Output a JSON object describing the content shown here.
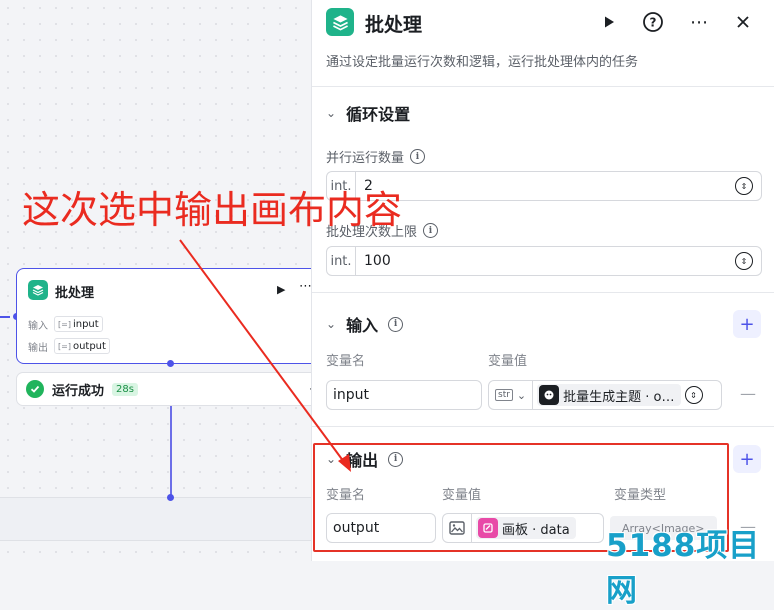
{
  "node": {
    "title": "批处理",
    "input_label": "输入",
    "input_tag": "input",
    "output_label": "输出",
    "output_tag": "output",
    "status": "运行成功",
    "duration": "28s"
  },
  "annotation": {
    "callout": "这次选中输出画布内容"
  },
  "panel": {
    "title": "批处理",
    "description": "通过设定批量运行次数和逻辑，运行批处理体内的任务",
    "loop": {
      "section": "循环设置",
      "parallel_label": "并行运行数量",
      "parallel_type": "int.",
      "parallel_value": "2",
      "limit_label": "批处理次数上限",
      "limit_type": "int.",
      "limit_value": "100"
    },
    "inputs": {
      "section": "输入",
      "col_name": "变量名",
      "col_value": "变量值",
      "rows": [
        {
          "name": "input",
          "type": "str",
          "ref": "批量生成主题 · o…"
        }
      ]
    },
    "outputs": {
      "section": "输出",
      "col_name": "变量名",
      "col_value": "变量值",
      "col_type": "变量类型",
      "rows": [
        {
          "name": "output",
          "ref": "画板 · data",
          "type": "Array<Image>"
        }
      ]
    }
  },
  "watermark": "5188项目网",
  "colors": {
    "accent": "#4d53e8",
    "brand": "#1fb38a",
    "annotation": "#ea2b20"
  }
}
